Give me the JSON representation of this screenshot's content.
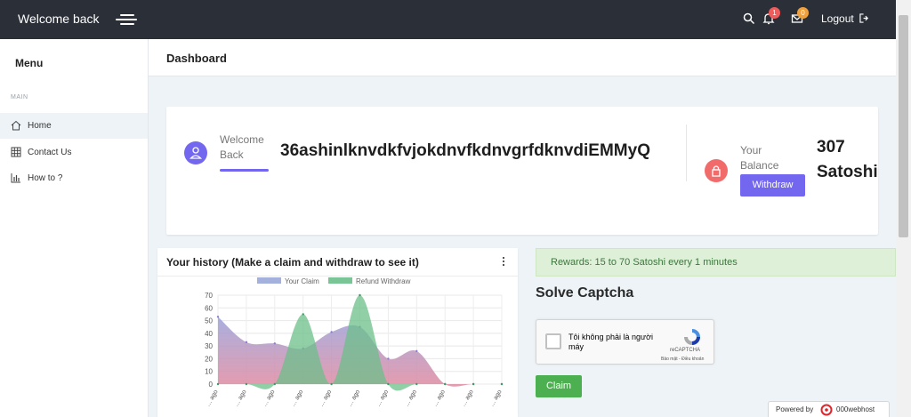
{
  "header": {
    "brand": "Welcome back",
    "notifications_count": "1",
    "messages_count": "0",
    "logout_label": "Logout",
    "notification_badge_color": "#f05b5b",
    "message_badge_color": "#f0a13b"
  },
  "sidebar": {
    "title": "Menu",
    "section": "MAIN",
    "items": [
      {
        "label": "Home",
        "icon": "home-icon",
        "active": true
      },
      {
        "label": "Contact Us",
        "icon": "grid-icon",
        "active": false
      },
      {
        "label": "How to ?",
        "icon": "bar-chart-icon",
        "active": false
      }
    ]
  },
  "page": {
    "title": "Dashboard"
  },
  "welcome_card": {
    "label": "Welcome Back",
    "username": "36ashinlknvdkfvjokdnvfkdnvgrfdknvdiEMMyQ",
    "balance_label": "Your Balance",
    "withdraw_label": "Withdraw",
    "balance_value": "307",
    "balance_unit": "Satoshi",
    "accent_color": "#7367f0",
    "balance_icon_color": "#f26b6b"
  },
  "history": {
    "title": "Your history (Make a claim and withdraw to see it)"
  },
  "chart_data": {
    "type": "area",
    "series": [
      {
        "name": "Your Claim",
        "color": "#9aa9d8",
        "values": [
          53,
          33,
          32,
          28,
          41,
          45,
          20,
          26,
          0,
          0,
          0
        ]
      },
      {
        "name": "Refund Withdraw",
        "color": "#6cbf8a",
        "values": [
          0,
          0,
          0,
          55,
          0,
          70,
          0,
          0,
          0,
          0,
          0
        ]
      }
    ],
    "x": [
      "… ago",
      "… ago",
      "… ago",
      "… ago",
      "… ago",
      "… ago",
      "… ago",
      "… ago",
      "… ago",
      "… ago",
      "… ago"
    ],
    "ylim": [
      0,
      70
    ],
    "yticks": [
      0,
      10,
      20,
      30,
      40,
      50,
      60,
      70
    ],
    "legend_position": "top",
    "grid": true
  },
  "rewards": {
    "text": "Rewards: 15 to 70 Satoshi every 1 minutes"
  },
  "captcha": {
    "title": "Solve Captcha",
    "checkbox_label": "Tôi không phải là người máy",
    "brand": "reCAPTCHA",
    "links": "Bảo mật - Điều khoản"
  },
  "claim_label": "Claim",
  "footer": {
    "powered_by": "Powered by",
    "host": "000webhost"
  }
}
